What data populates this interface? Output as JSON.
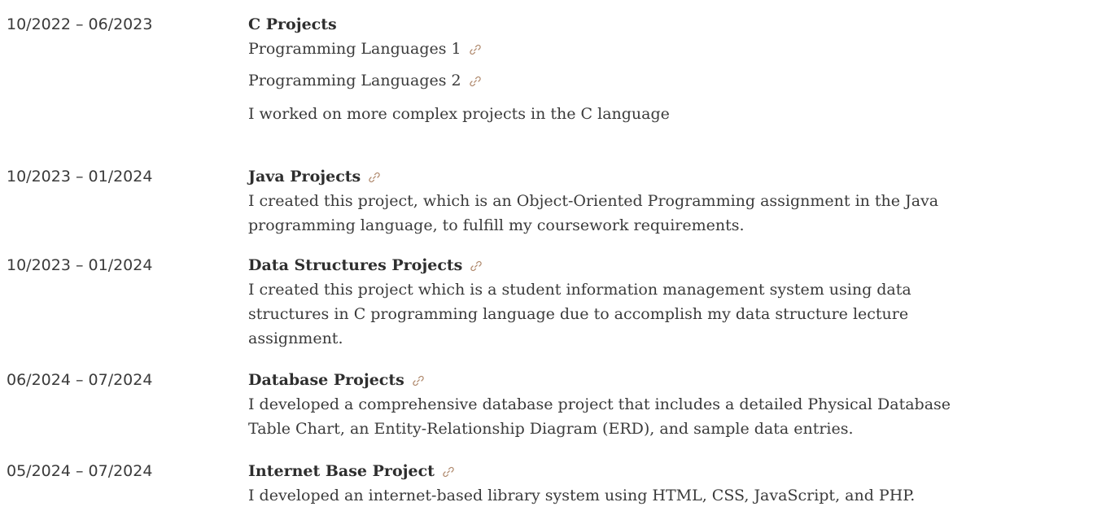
{
  "colors": {
    "text": "#3a3a3a",
    "heading": "#2e2e2e",
    "link_icon": "#b08a6e"
  },
  "entries": [
    {
      "date": "10/2022 – 06/2023",
      "title": "C Projects",
      "links": [
        "Programming Languages 1",
        "Programming Languages 2"
      ],
      "description": "I worked on more complex projects in the C language",
      "icon": "link-icon"
    },
    {
      "date": "10/2023 – 01/2024",
      "title": "Java Projects",
      "description_lines": [
        "I created this project, which is an Object-Oriented Programming assignment in the Java",
        "programming language, to fulfill my coursework requirements."
      ],
      "icon": "link-icon"
    },
    {
      "date": "10/2023 – 01/2024",
      "title": "Data Structures Projects",
      "description_lines": [
        "I created this project which is a student information management system using data",
        "structures in C programming language due to accomplish my data structure lecture",
        "assignment."
      ],
      "icon": "link-icon"
    },
    {
      "date": "06/2024 – 07/2024",
      "title": "Database Projects",
      "description_lines": [
        "I developed a comprehensive database project that includes a detailed Physical Database",
        "Table Chart, an Entity-Relationship Diagram (ERD), and sample data entries."
      ],
      "icon": "link-icon"
    },
    {
      "date": "05/2024 – 07/2024",
      "title": "Internet Base Project",
      "description_lines": [
        "I developed an internet-based library system using HTML, CSS, JavaScript, and PHP."
      ],
      "icon": "link-icon"
    }
  ]
}
